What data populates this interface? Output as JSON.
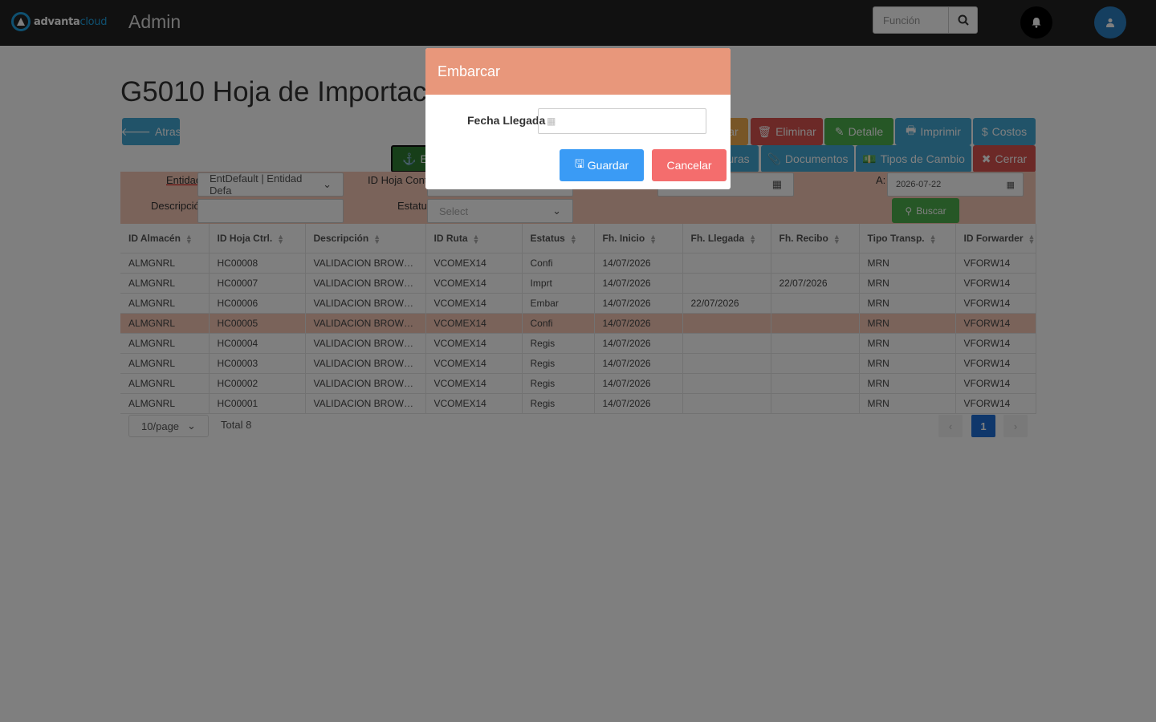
{
  "header": {
    "logo_text": "advanta",
    "logo_accent": "cloud",
    "app_title": "Admin",
    "search_placeholder": "Función",
    "search_icon": "search-icon",
    "bell_icon": "bell-icon",
    "user_icon": "user-icon"
  },
  "page": {
    "title": "G5010 Hoja de Importación",
    "back_label": "Atras",
    "embarcar_label": "E",
    "toolbar_row1": [
      {
        "label": "ar",
        "icon": ""
      },
      {
        "label": "Eliminar",
        "icon": "🗑"
      },
      {
        "label": "Detalle",
        "icon": "✎"
      },
      {
        "label": "Imprimir",
        "icon": "🖶"
      },
      {
        "label": "Costos",
        "icon": "$"
      }
    ],
    "toolbar_row2": [
      {
        "label": "uras",
        "icon": ""
      },
      {
        "label": "Documentos",
        "icon": "📎"
      },
      {
        "label": "Tipos de Cambio",
        "icon": "💵"
      },
      {
        "label": "Cerrar",
        "icon": "✖"
      }
    ]
  },
  "filters": {
    "entidad_label": "Entidad",
    "entidad_value": "EntDefault | Entidad Defa",
    "descripcion_label": "Descripción",
    "id_hoja_label": "ID Hoja Control",
    "estatus_label": "Estatus",
    "estatus_placeholder": "Select",
    "a_label": "A:",
    "a_value": "2026-07-22",
    "buscar_label": "Buscar"
  },
  "table": {
    "columns": [
      "ID Almacén",
      "ID Hoja Ctrl.",
      "Descripción",
      "ID Ruta",
      "Estatus",
      "Fh. Inicio",
      "Fh. Llegada",
      "Fh. Recibo",
      "Tipo Transp.",
      "ID Forwarder"
    ],
    "rows": [
      [
        "ALMGNRL",
        "HC00008",
        "VALIDACION BROWSER ...",
        "VCOMEX14",
        "Confi",
        "14/07/2026",
        "",
        "",
        "MRN",
        "VFORW14"
      ],
      [
        "ALMGNRL",
        "HC00007",
        "VALIDACION BROWSER ...",
        "VCOMEX14",
        "Imprt",
        "14/07/2026",
        "",
        "22/07/2026",
        "MRN",
        "VFORW14"
      ],
      [
        "ALMGNRL",
        "HC00006",
        "VALIDACION BROWSER ...",
        "VCOMEX14",
        "Embar",
        "14/07/2026",
        "22/07/2026",
        "",
        "MRN",
        "VFORW14"
      ],
      [
        "ALMGNRL",
        "HC00005",
        "VALIDACION BROWSER ...",
        "VCOMEX14",
        "Confi",
        "14/07/2026",
        "",
        "",
        "MRN",
        "VFORW14"
      ],
      [
        "ALMGNRL",
        "HC00004",
        "VALIDACION BROWSER ...",
        "VCOMEX14",
        "Regis",
        "14/07/2026",
        "",
        "",
        "MRN",
        "VFORW14"
      ],
      [
        "ALMGNRL",
        "HC00003",
        "VALIDACION BROWSER ...",
        "VCOMEX14",
        "Regis",
        "14/07/2026",
        "",
        "",
        "MRN",
        "VFORW14"
      ],
      [
        "ALMGNRL",
        "HC00002",
        "VALIDACION BROWSER ...",
        "VCOMEX14",
        "Regis",
        "14/07/2026",
        "",
        "",
        "MRN",
        "VFORW14"
      ],
      [
        "ALMGNRL",
        "HC00001",
        "VALIDACION BROWSER ...",
        "VCOMEX14",
        "Regis",
        "14/07/2026",
        "",
        "",
        "MRN",
        "VFORW14"
      ]
    ],
    "selected_row": 3
  },
  "pagination": {
    "page_size": "10/page",
    "total": "Total 8",
    "current_page": "1",
    "prev": "‹",
    "next": "›"
  },
  "modal": {
    "title": "Embarcar",
    "field_label": "Fecha Llegada",
    "field_value": "",
    "save_label": "Guardar",
    "cancel_label": "Cancelar"
  },
  "colors": {
    "topbar": "#222222",
    "modal_header": "#e8977b",
    "filter_panel": "#f5c6b5",
    "save": "#3a9bf5",
    "cancel": "#f46d6d"
  }
}
